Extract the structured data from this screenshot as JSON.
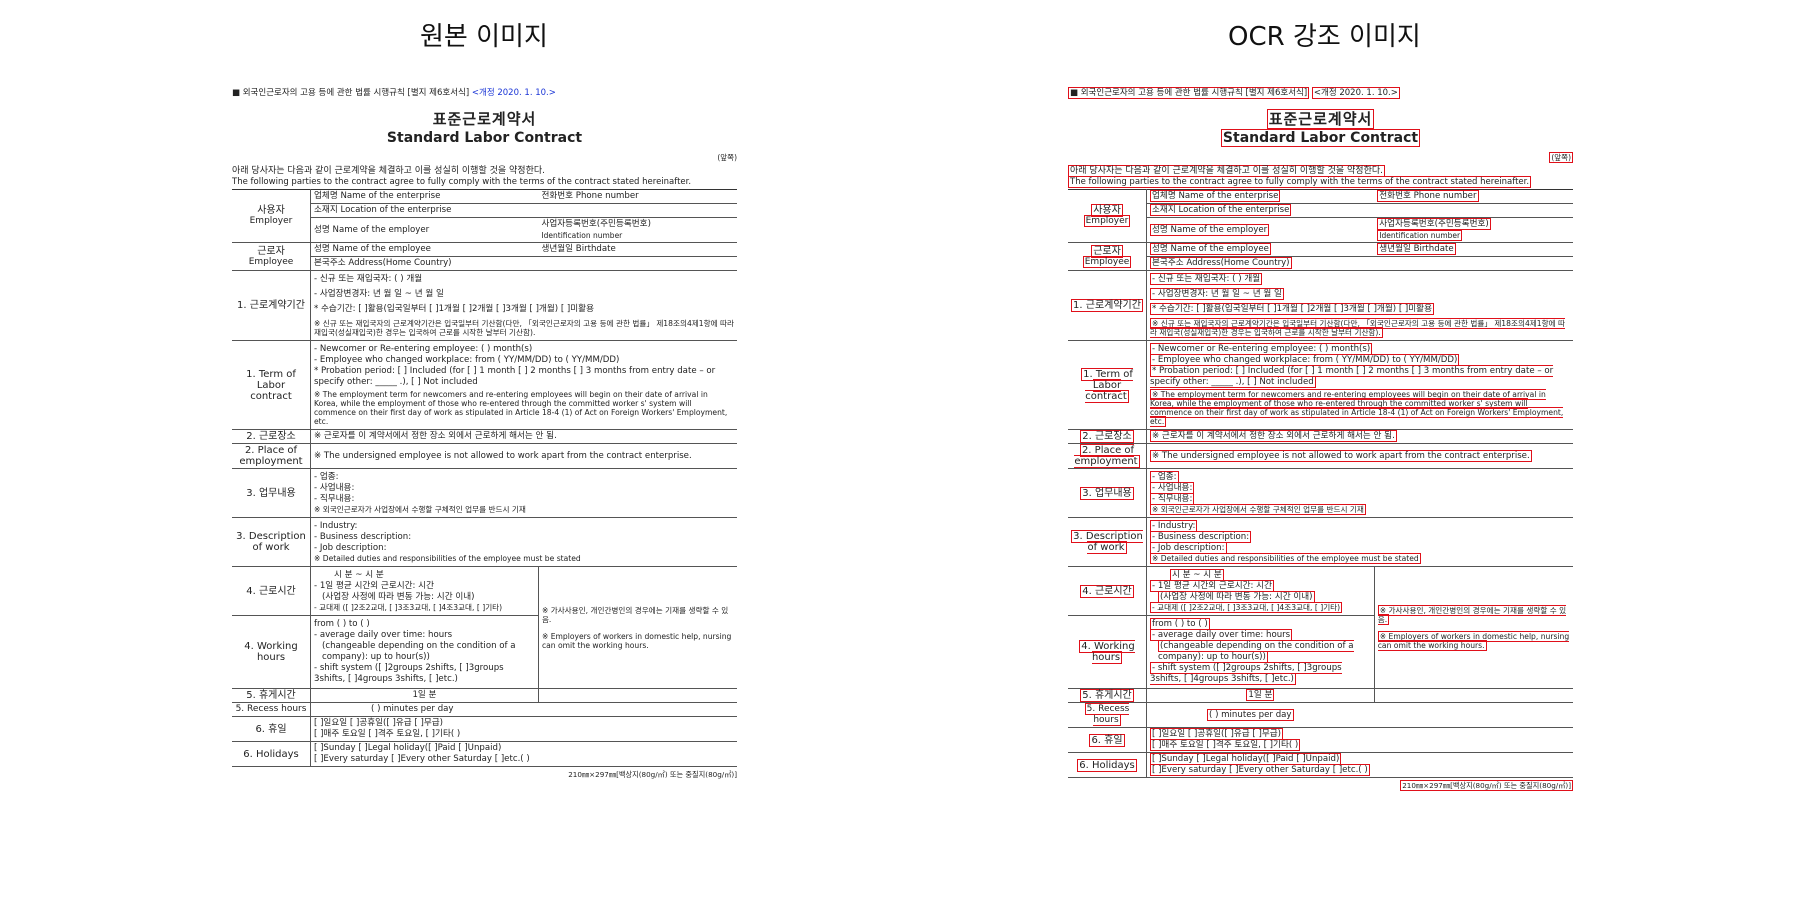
{
  "panels": {
    "left_title": "원본 이미지",
    "right_title": "OCR 강조 이미지"
  },
  "doc": {
    "header_prefix": "■ 외국인근로자의 고용 등에 관한 법률 시행규칙 [별지 제6호서식]",
    "header_revision": "<개정 2020. 1. 10.>",
    "title_ko": "표준근로계약서",
    "title_en": "Standard Labor Contract",
    "page_no": "(앞쪽)",
    "intro_ko": "아래 당사자는 다음과 같이 근로계약을 체결하고 이를 성실히 이행할 것을 약정한다.",
    "intro_en": "The following parties to the contract agree to fully comply with the terms of the contract stated hereinafter.",
    "employer": {
      "label_ko": "사용자",
      "label_en": "Employer",
      "name": "업체명 Name of the enterprise",
      "phone": "전화번호 Phone number",
      "location": "소재지 Location of the enterprise",
      "employer_name": "성명 Name of the employer",
      "reg_no": "사업자등록번호(주민등록번호)",
      "reg_no_en": "Identification number"
    },
    "employee": {
      "label_ko": "근로자",
      "label_en": "Employee",
      "name": "성명 Name of the employee",
      "birthdate": "생년월일 Birthdate",
      "address": "본국주소 Address(Home Country)"
    },
    "term_ko": {
      "label": "1. 근로계약기간",
      "l1": "- 신규 또는 재입국자: (          ) 개월",
      "l2": "- 사업장변경자:       년    월    일 ~    년    월    일",
      "l3": "* 수습기간: [ ]활용(입국일부터 [ ]1개월  [ ]2개월  [ ]3개월 [   ]개월)   [ ]미활용",
      "note": "※ 신규 또는 재입국자의 근로계약기간은 입국일부터 기산함(다만, 「외국인근로자의 고용 등에 관한 법률」 제18조의4제1항에 따라 재입국(성실재입국)한 경우는 입국하여 근로를 시작한 날부터 기산함)."
    },
    "term_en": {
      "label": "1. Term of Labor contract",
      "l1": "- Newcomer or Re-entering employee: (     ) month(s)",
      "l2": "- Employee who changed workplace: from (    YY/MM/DD) to (   YY/MM/DD)",
      "l3": "* Probation period: [ ] Included (for [ ] 1 month  [ ] 2 months  [ ] 3 months from entry date – or specify other: _____ .), [ ] Not included",
      "note": "※ The employment term for newcomers and re-entering employees will begin on their date of arrival in Korea, while the employment of those who re-entered through the committed worker s' system will commence on their first day of work as stipulated in Article 18-4 (1) of Act on Foreign Workers' Employment, etc."
    },
    "place_ko": {
      "label": "2. 근로장소",
      "text": "※ 근로자를 이 계약서에서 정한 장소 외에서 근로하게 해서는 안 됨."
    },
    "place_en": {
      "label": "2. Place of employment",
      "text": "※ The undersigned employee is not allowed to work apart from the contract enterprise."
    },
    "work_ko": {
      "label": "3. 업무내용",
      "l1": "- 업종:",
      "l2": "- 사업내용:",
      "l3": "- 직무내용:",
      "note": "※ 외국인근로자가 사업장에서 수행할 구체적인 업무를 반드시 기재"
    },
    "work_en": {
      "label": "3. Description of work",
      "l1": "- Industry:",
      "l2": "- Business description:",
      "l3": "- Job description:",
      "note": "※ Detailed duties and responsibilities of the employee must be stated"
    },
    "hours_ko": {
      "label": "4. 근로시간",
      "l1": "시    분 ~    시    분",
      "l2": "- 1일 평균 시간외 근로시간:       시간",
      "l3": "(사업장 사정에 따라 변동 가능:          시간 이내)",
      "l4": "- 교대제 ([ ]2조2교대, [ ]3조3교대, [ ]4조3교대, [ ]기타)"
    },
    "hours_en": {
      "label": "4. Working hours",
      "l1": "from (          )       to (          )",
      "l2": "- average daily over time:          hours",
      "l3": "(changeable depending on the condition of a company): up to        hour(s))",
      "l4": "- shift system ([ ]2groups 2shifts, [ ]3groups 3shifts, [ ]4groups 3shifts, [ ]etc.)"
    },
    "hours_note_ko": "※ 가사사용인, 개인간병인의 경우에는 기재를 생략할 수 있음.",
    "hours_note_en": "※ Employers of workers in domestic help, nursing can omit the working hours.",
    "recess_ko": {
      "label": "5. 휴게시간",
      "text": "1일          분"
    },
    "recess_en": {
      "label": "5. Recess hours",
      "text": "(          ) minutes per day"
    },
    "holidays_ko": {
      "label": "6. 휴일",
      "l1": "[ ]일요일 [ ]공휴일([ ]유급 [ ]무급)",
      "l2": "[ ]매주 토요일 [ ]격주 토요일, [ ]기타(       )"
    },
    "holidays_en": {
      "label": "6. Holidays",
      "l1": "[ ]Sunday [ ]Legal holiday([ ]Paid [ ]Unpaid)",
      "l2": "[ ]Every saturday [ ]Every other Saturday [ ]etc.(        )"
    },
    "footer": "210㎜×297㎜[백상지(80g/㎡) 또는 중질지(80g/㎡)]"
  }
}
